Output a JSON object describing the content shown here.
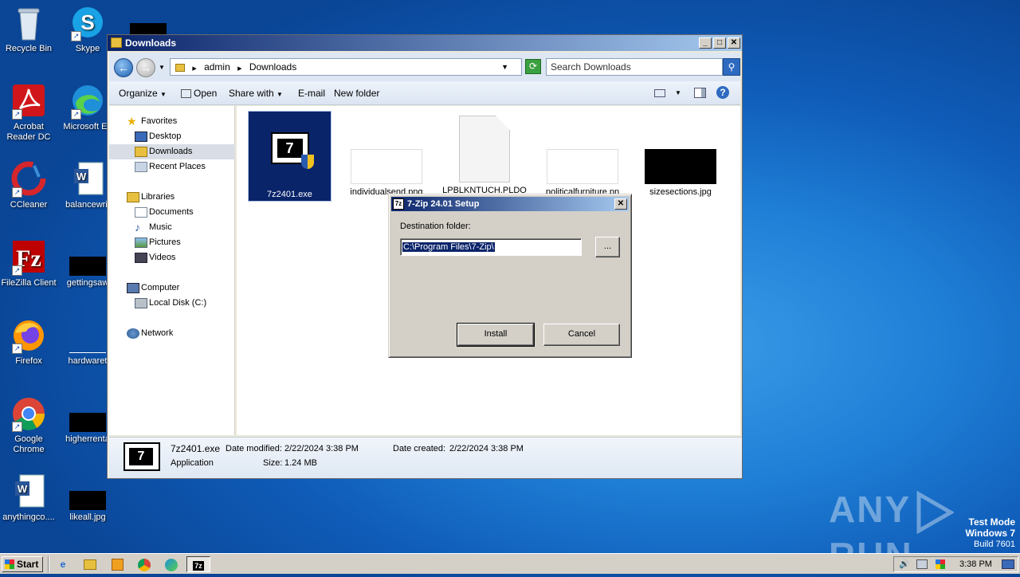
{
  "desktop": {
    "icons": [
      {
        "label": "Recycle Bin",
        "icon": "recycle-bin-icon"
      },
      {
        "label": "Skype",
        "icon": "skype-icon"
      },
      {
        "label": "Acrobat Reader DC",
        "label_lines": [
          "Acrobat",
          "Reader DC"
        ],
        "icon": "acrobat-icon"
      },
      {
        "label": "Microsoft Ed",
        "icon": "edge-icon"
      },
      {
        "label": "CCleaner",
        "icon": "ccleaner-icon"
      },
      {
        "label": "balancewrit",
        "icon": "word-doc-icon"
      },
      {
        "label": "FileZilla Client",
        "icon": "filezilla-icon"
      },
      {
        "label": "gettingsaw",
        "icon": "black-thumbnail-icon"
      },
      {
        "label": "Firefox",
        "icon": "firefox-icon"
      },
      {
        "label": "hardwaret",
        "icon": "blank-thumbnail-icon"
      },
      {
        "label": "Google Chrome",
        "label_lines": [
          "Google",
          "Chrome"
        ],
        "icon": "chrome-icon"
      },
      {
        "label": "higherrenta",
        "icon": "black-thumbnail-icon"
      },
      {
        "label": "anythingco....",
        "icon": "word-doc-icon"
      },
      {
        "label": "likeall.jpg",
        "icon": "black-thumbnail-icon"
      }
    ],
    "watermark": {
      "left": "ANY",
      "right": "RUN"
    },
    "test_mode": {
      "line1": "Test Mode",
      "line2": "Windows 7",
      "line3": "Build 7601"
    }
  },
  "explorer": {
    "title": "Downloads",
    "address": {
      "segments": [
        "admin",
        "Downloads"
      ]
    },
    "search_placeholder": "Search Downloads",
    "toolbar": {
      "organize": "Organize",
      "open": "Open",
      "share_with": "Share with",
      "email": "E-mail",
      "new_folder": "New folder"
    },
    "nav": {
      "favorites": "Favorites",
      "desktop": "Desktop",
      "downloads": "Downloads",
      "recent_places": "Recent Places",
      "libraries": "Libraries",
      "documents": "Documents",
      "music": "Music",
      "pictures": "Pictures",
      "videos": "Videos",
      "computer": "Computer",
      "local_disk": "Local Disk (C:)",
      "network": "Network"
    },
    "files": [
      {
        "name": "7z2401.exe",
        "selected": true
      },
      {
        "name": "individualsend.png"
      },
      {
        "name": "LPBLKNTUCH.PLDO"
      },
      {
        "name": "politicalfurniture.pn"
      },
      {
        "name": "sizesections.jpg"
      }
    ],
    "details": {
      "name": "7z2401.exe",
      "type": "Application",
      "modified_label": "Date modified:",
      "modified": "2/22/2024 3:38 PM",
      "size_label": "Size:",
      "size": "1.24 MB",
      "created_label": "Date created:",
      "created": "2/22/2024 3:38 PM"
    }
  },
  "dialog": {
    "title": "7-Zip 24.01 Setup",
    "icon_text": "7z",
    "dest_label": "Destination folder:",
    "dest_value": "C:\\Program Files\\7-Zip\\",
    "browse": "...",
    "install": "Install",
    "cancel": "Cancel"
  },
  "taskbar": {
    "start": "Start",
    "active_app_icon": "7z",
    "clock": "3:38 PM"
  },
  "colors": {
    "title_active": "#0a246a",
    "desktop": "#1f7fd6",
    "selection": "#0a246a"
  }
}
